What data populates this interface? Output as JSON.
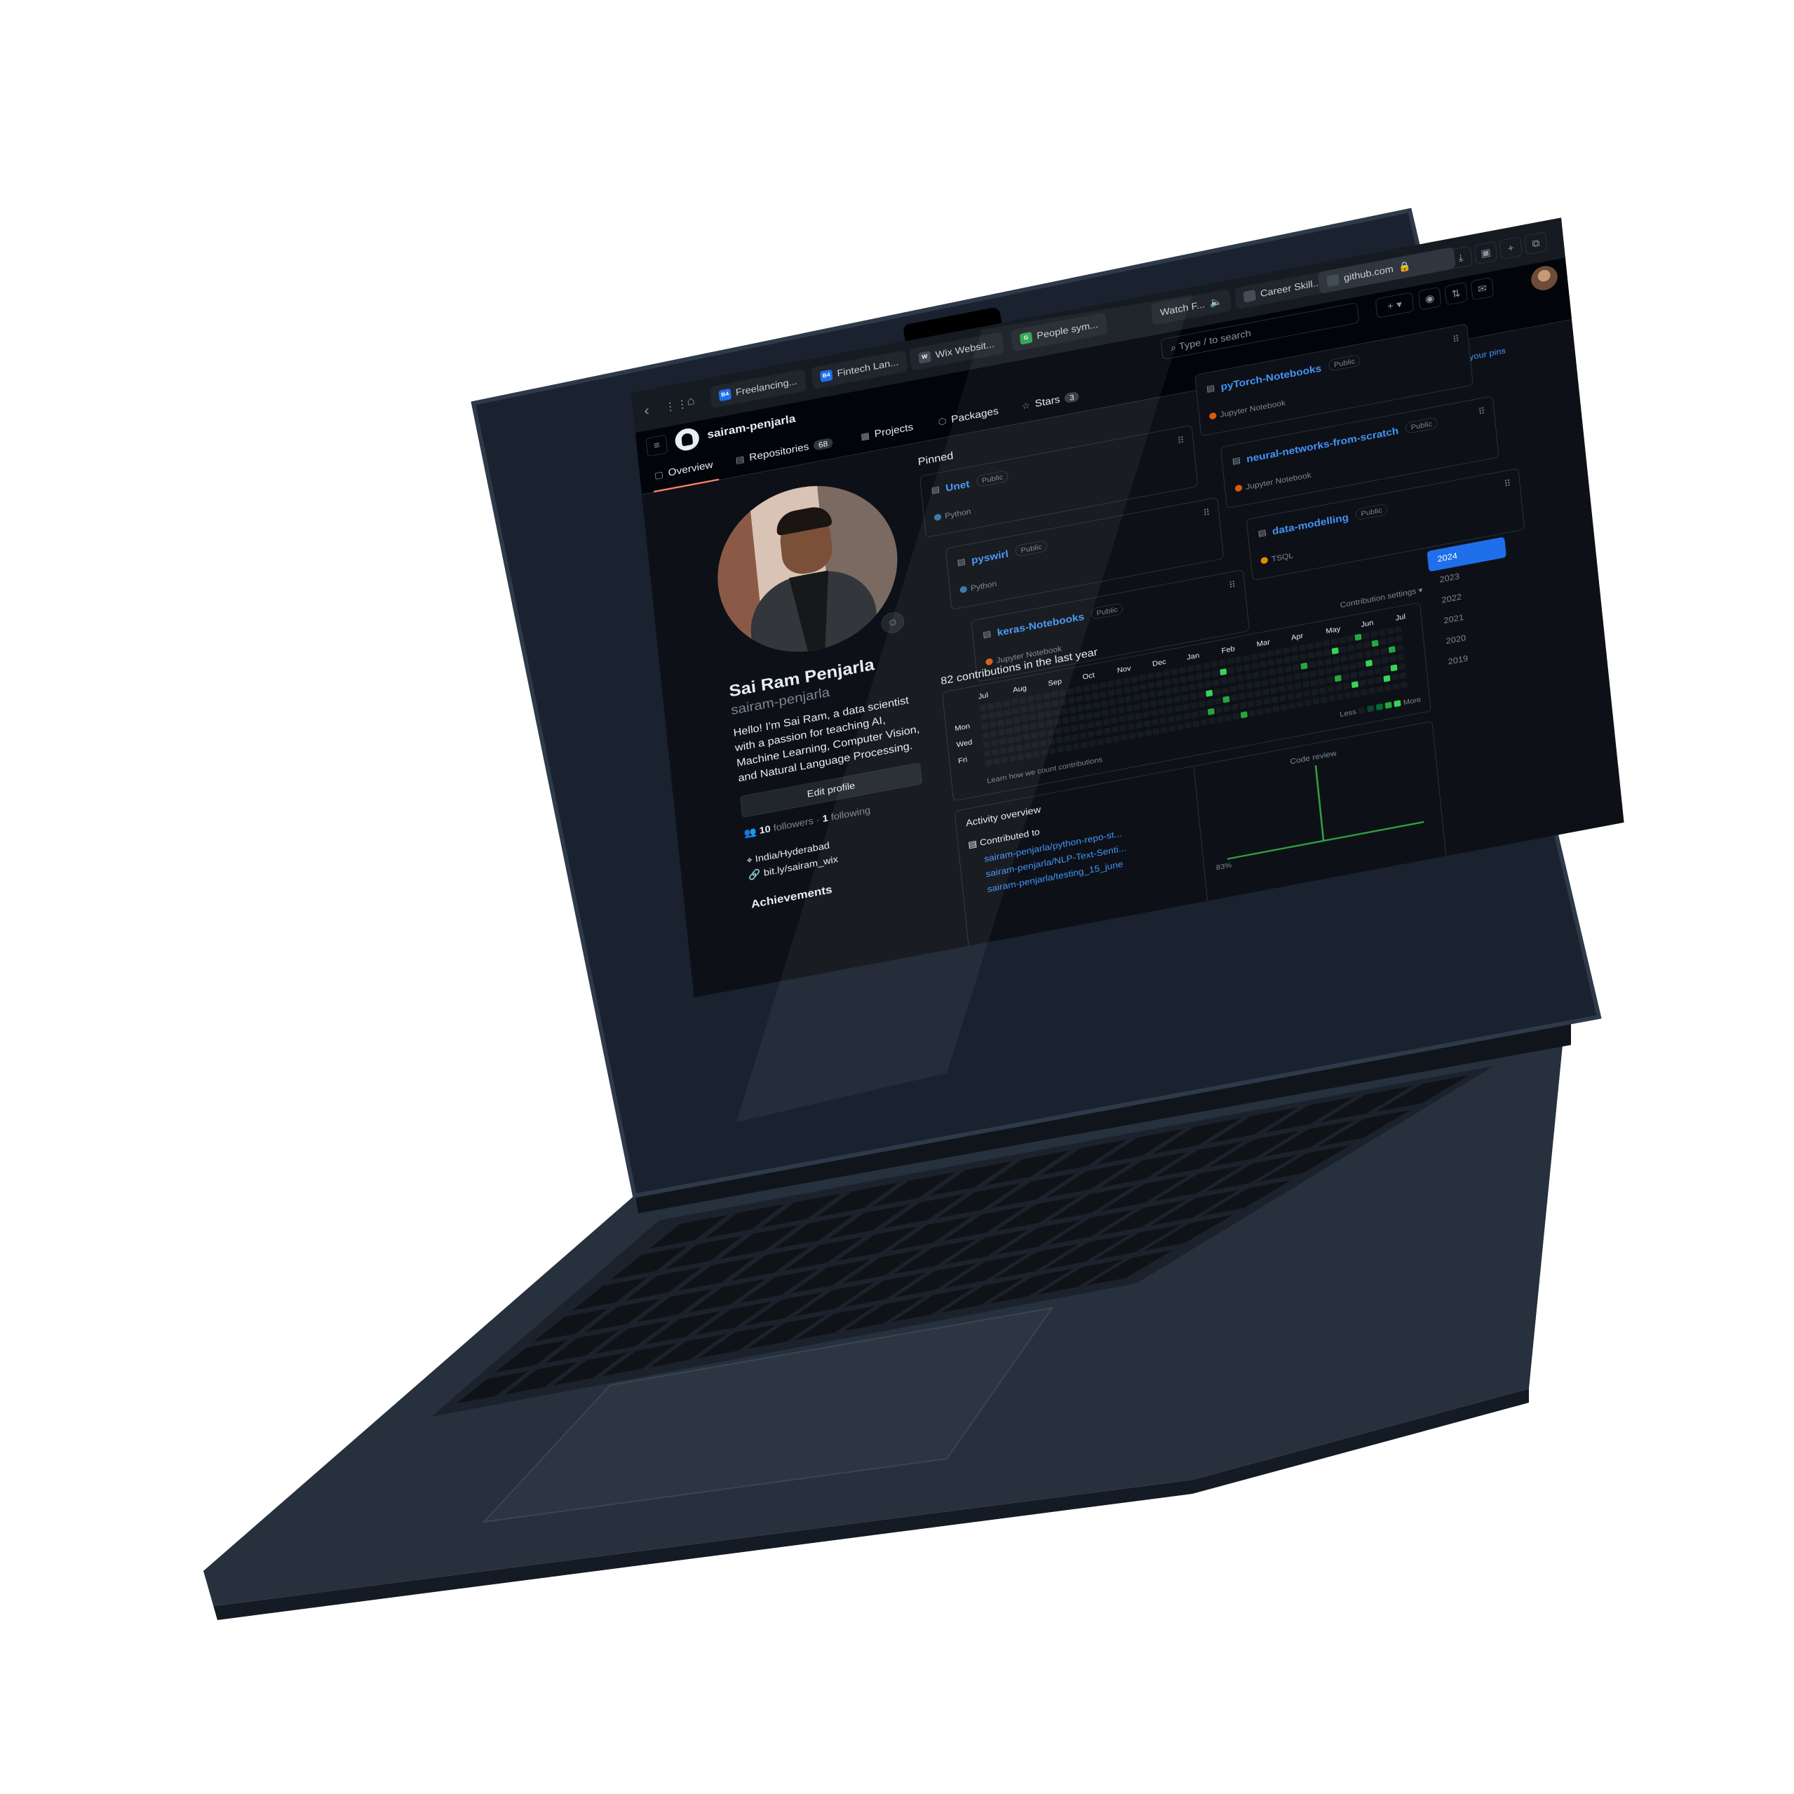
{
  "browser": {
    "tabs": [
      {
        "label": "Freelancing...",
        "favicon": "B4"
      },
      {
        "label": "Fintech Lan...",
        "favicon": "B4"
      },
      {
        "label": "Wix Websit...",
        "favicon": "W"
      },
      {
        "label": "People sym...",
        "favicon": "G"
      },
      {
        "label": "Watch F...",
        "favicon": ""
      },
      {
        "label": "Career Skill...",
        "favicon": ""
      },
      {
        "label": "github.com",
        "favicon": ""
      }
    ]
  },
  "header": {
    "username": "sairam-penjarla",
    "search_placeholder": "Type / to search"
  },
  "nav": {
    "overview": "Overview",
    "repositories": "Repositories",
    "repositories_count": "68",
    "projects": "Projects",
    "packages": "Packages",
    "stars": "Stars",
    "stars_count": "3"
  },
  "profile": {
    "fullname": "Sai Ram Penjarla",
    "login": "sairam-penjarla",
    "bio": "Hello! I'm Sai Ram, a data scientist with a passion for teaching AI, Machine Learning, Computer Vision, and Natural Language Processing.",
    "edit_button": "Edit profile",
    "followers": "10",
    "followers_label": "followers",
    "separator": "·",
    "following": "1",
    "following_label": "following",
    "location": "India/Hyderabad",
    "website": "bit.ly/sairam_wix",
    "achievements": "Achievements"
  },
  "pinned": {
    "title": "Pinned",
    "customize": "Customize your pins",
    "items": [
      {
        "name": "Unet",
        "visibility": "Public",
        "language": "Python",
        "lang_color": "#3572A5"
      },
      {
        "name": "pyTorch-Notebooks",
        "visibility": "Public",
        "language": "Jupyter Notebook",
        "lang_color": "#DA5B0B"
      },
      {
        "name": "pyswirl",
        "visibility": "Public",
        "language": "Python",
        "lang_color": "#3572A5"
      },
      {
        "name": "neural-networks-from-scratch",
        "visibility": "Public",
        "language": "Jupyter Notebook",
        "lang_color": "#DA5B0B"
      },
      {
        "name": "keras-Notebooks",
        "visibility": "Public",
        "language": "Jupyter Notebook",
        "lang_color": "#DA5B0B"
      },
      {
        "name": "data-modelling",
        "visibility": "Public",
        "language": "TSQL",
        "lang_color": "#E38C00"
      }
    ]
  },
  "contributions": {
    "title": "82 contributions in the last year",
    "settings": "Contribution settings ▾",
    "months": [
      "Jul",
      "Aug",
      "Sep",
      "Oct",
      "Nov",
      "Dec",
      "Jan",
      "Feb",
      "Mar",
      "Apr",
      "May",
      "Jun",
      "Jul"
    ],
    "days": [
      "Mon",
      "Wed",
      "Fri"
    ],
    "learn": "Learn how we count contributions",
    "less": "Less",
    "more": "More",
    "years": [
      "2024",
      "2023",
      "2022",
      "2021",
      "2020",
      "2019"
    ],
    "selected_year": "2024"
  },
  "activity": {
    "title": "Activity overview",
    "contributed_to": "Contributed to",
    "repos": [
      "sairam-penjarla/python-repo-st...",
      "sairam-penjarla/NLP-Text-Senti...",
      "sairam-penjarla/testing_15_june"
    ],
    "code_review": "Code review",
    "percent": "83%"
  },
  "colors": {
    "accent": "#4493f8",
    "background": "#0d1117",
    "green_high": "#39d353",
    "green_mid": "#26a641",
    "green_low": "#006d32",
    "cell_empty": "#161b22"
  }
}
